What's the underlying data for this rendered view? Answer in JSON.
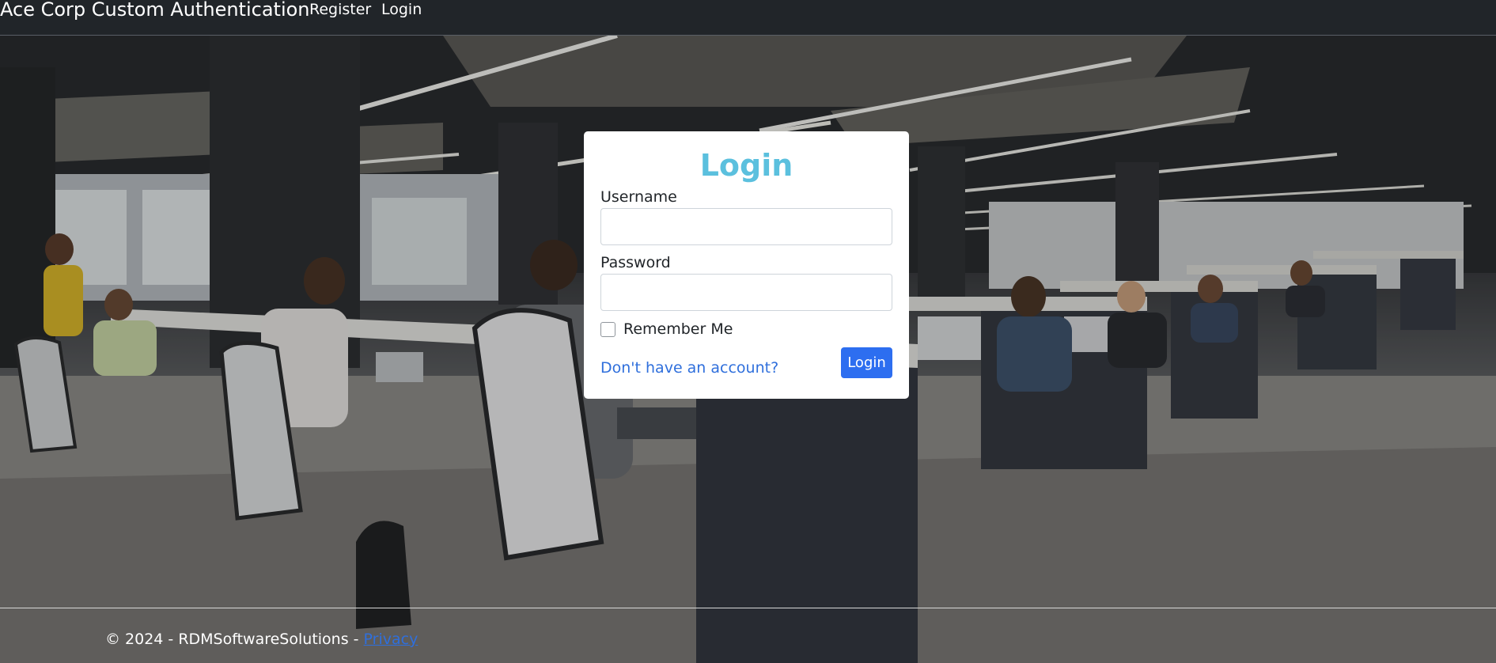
{
  "navbar": {
    "brand": "Ace Corp Custom Authentication",
    "links": [
      {
        "label": "Register"
      },
      {
        "label": "Login"
      }
    ]
  },
  "login_card": {
    "title": "Login",
    "username": {
      "label": "Username",
      "value": "",
      "placeholder": ""
    },
    "password": {
      "label": "Password",
      "value": "",
      "placeholder": ""
    },
    "remember_me": {
      "label": "Remember Me",
      "checked": false
    },
    "register_link": "Don't have an account?",
    "submit_label": "Login"
  },
  "footer": {
    "copyright": "© 2024 - RDMSoftwareSolutions - ",
    "privacy_link": "Privacy"
  },
  "colors": {
    "navbar_bg": "#212529",
    "title": "#5bc0de",
    "primary_button": "#2d6ef0",
    "link": "#2f6fdc"
  },
  "background_image": {
    "description_icon": "office-photo-background"
  }
}
